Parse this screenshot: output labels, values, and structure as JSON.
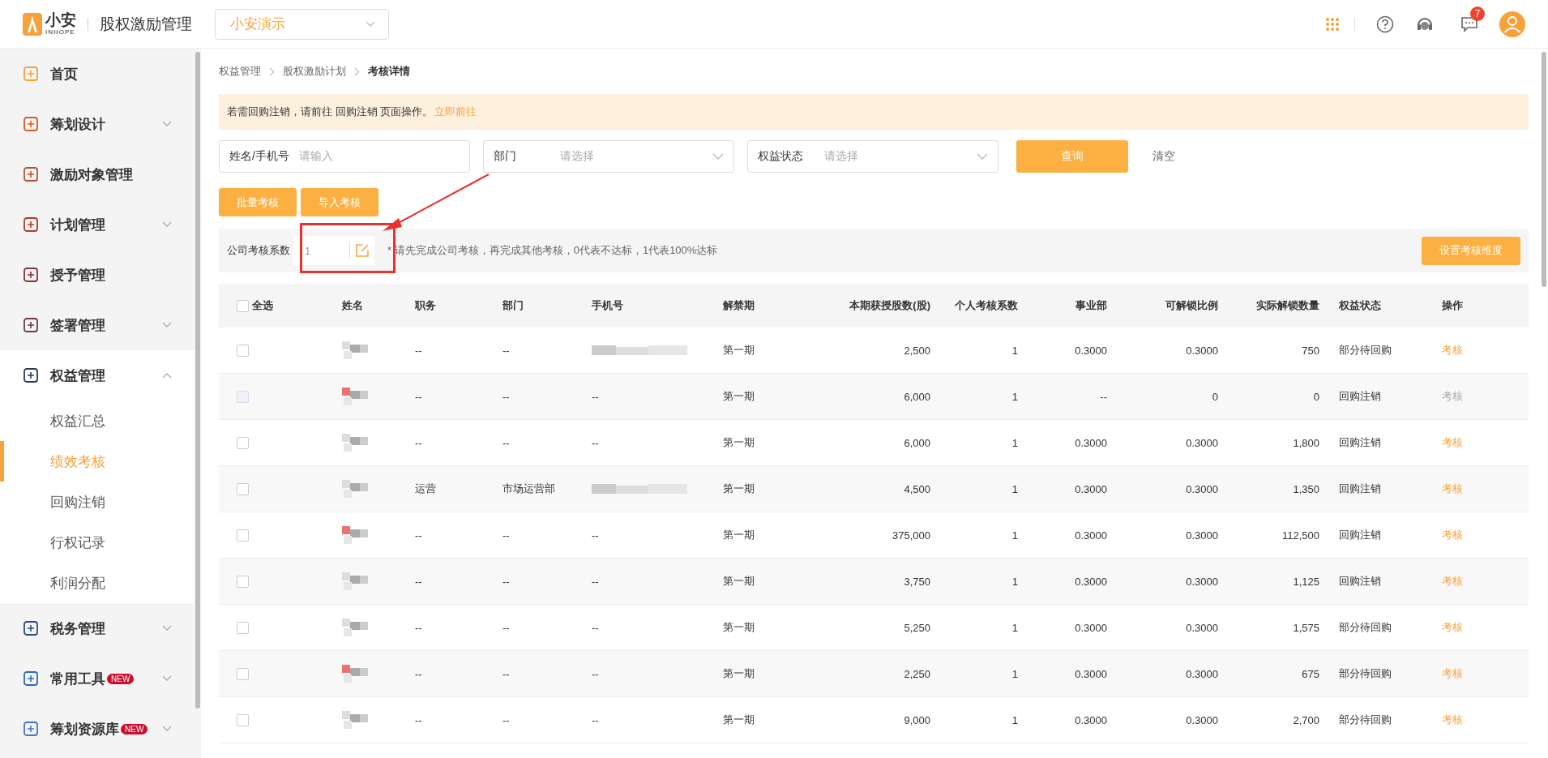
{
  "header": {
    "logo_text": "小安",
    "logo_sub": "INHOPE",
    "app_title": "股权激励管理",
    "company_select": {
      "value": "小安演示"
    },
    "notification_count": "7"
  },
  "sidebar": {
    "items": [
      {
        "label": "首页"
      },
      {
        "label": "筹划设计",
        "expanded": false
      },
      {
        "label": "激励对象管理"
      },
      {
        "label": "计划管理",
        "expanded": false
      },
      {
        "label": "授予管理"
      },
      {
        "label": "签署管理",
        "expanded": false
      },
      {
        "label": "权益管理",
        "expanded": true,
        "children": [
          {
            "label": "权益汇总",
            "selected": false
          },
          {
            "label": "绩效考核",
            "selected": true
          },
          {
            "label": "回购注销",
            "selected": false
          },
          {
            "label": "行权记录",
            "selected": false
          },
          {
            "label": "利润分配",
            "selected": false
          }
        ]
      },
      {
        "label": "税务管理",
        "expanded": false
      },
      {
        "label": "常用工具",
        "badge": "NEW",
        "expanded": false
      },
      {
        "label": "筹划资源库",
        "badge": "NEW",
        "expanded": false
      }
    ]
  },
  "breadcrumb": [
    "权益管理",
    "股权激励计划",
    "考核详情"
  ],
  "notice": {
    "text": "若需回购注销，请前往 回购注销 页面操作。",
    "link": "立即前往"
  },
  "filters": [
    {
      "kind": "input",
      "label": "姓名/手机号",
      "placeholder": "请输入"
    },
    {
      "kind": "select",
      "label": "部门",
      "placeholder": "请选择"
    },
    {
      "kind": "select",
      "label": "权益状态",
      "placeholder": "请选择"
    }
  ],
  "query_button": "查询",
  "clear_link": "清空",
  "actions": [
    "批量考核",
    "导入考核"
  ],
  "coefficient": {
    "label": "公司考核系数",
    "value": "1",
    "hint": "* 请先完成公司考核，再完成其他考核，0代表不达标，1代表100%达标",
    "button": "设置考核维度",
    "highlighted": true
  },
  "table": {
    "select_all": {
      "label": "全选",
      "checked": false
    },
    "columns": [
      "姓名",
      "职务",
      "部门",
      "手机号",
      "解禁期",
      "本期获授股数(股)",
      "个人考核系数",
      "事业部",
      "可解锁比例",
      "实际解锁数量",
      "权益状态",
      "操作"
    ],
    "rows": [
      {
        "checked": false,
        "disabled": false,
        "name_redacted": true,
        "position": "--",
        "department": "--",
        "phone_redacted": true,
        "period": "第一期",
        "shares": "2,500",
        "personal": "1",
        "division": "0.3000",
        "ratio": "0.3000",
        "unlocked": "750",
        "status": "部分待回购",
        "action": "考核"
      },
      {
        "checked": false,
        "disabled": true,
        "name_redacted": true,
        "position": "--",
        "department": "--",
        "phone": "--",
        "period": "第一期",
        "shares": "6,000",
        "personal": "1",
        "division": "--",
        "ratio": "0",
        "unlocked": "0",
        "status": "回购注销",
        "action": "考核"
      },
      {
        "checked": false,
        "disabled": false,
        "name_redacted": true,
        "position": "--",
        "department": "--",
        "phone": "--",
        "period": "第一期",
        "shares": "6,000",
        "personal": "1",
        "division": "0.3000",
        "ratio": "0.3000",
        "unlocked": "1,800",
        "status": "回购注销",
        "action": "考核"
      },
      {
        "checked": false,
        "disabled": false,
        "name_redacted": true,
        "position": "运营",
        "department": "市场运营部",
        "phone_redacted": true,
        "period": "第一期",
        "shares": "4,500",
        "personal": "1",
        "division": "0.3000",
        "ratio": "0.3000",
        "unlocked": "1,350",
        "status": "回购注销",
        "action": "考核"
      },
      {
        "checked": false,
        "disabled": false,
        "name_redacted": true,
        "position": "--",
        "department": "--",
        "phone": "--",
        "period": "第一期",
        "shares": "375,000",
        "personal": "1",
        "division": "0.3000",
        "ratio": "0.3000",
        "unlocked": "112,500",
        "status": "回购注销",
        "action": "考核"
      },
      {
        "checked": false,
        "disabled": false,
        "name_redacted": true,
        "position": "--",
        "department": "--",
        "phone": "--",
        "period": "第一期",
        "shares": "3,750",
        "personal": "1",
        "division": "0.3000",
        "ratio": "0.3000",
        "unlocked": "1,125",
        "status": "回购注销",
        "action": "考核"
      },
      {
        "checked": false,
        "disabled": false,
        "name_redacted": true,
        "position": "--",
        "department": "--",
        "phone": "--",
        "period": "第一期",
        "shares": "5,250",
        "personal": "1",
        "division": "0.3000",
        "ratio": "0.3000",
        "unlocked": "1,575",
        "status": "部分待回购",
        "action": "考核"
      },
      {
        "checked": false,
        "disabled": false,
        "name_redacted": true,
        "position": "--",
        "department": "--",
        "phone": "--",
        "period": "第一期",
        "shares": "2,250",
        "personal": "1",
        "division": "0.3000",
        "ratio": "0.3000",
        "unlocked": "675",
        "status": "部分待回购",
        "action": "考核"
      },
      {
        "checked": false,
        "disabled": false,
        "name_redacted": true,
        "position": "--",
        "department": "--",
        "phone": "--",
        "period": "第一期",
        "shares": "9,000",
        "personal": "1",
        "division": "0.3000",
        "ratio": "0.3000",
        "unlocked": "2,700",
        "status": "部分待回购",
        "action": "考核"
      }
    ]
  }
}
